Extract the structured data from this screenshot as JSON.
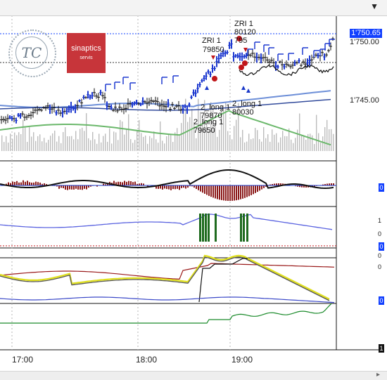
{
  "window": {
    "menu_glyph": "▼"
  },
  "price_axis": {
    "current": "1'750.65",
    "level_1": "1'750.00",
    "level_2": "1'745.00"
  },
  "annotations": [
    {
      "text": "ZRI 1",
      "x": 287,
      "y": 52
    },
    {
      "text": "79850",
      "x": 288,
      "y": 65
    },
    {
      "text": "ZRI 1",
      "x": 333,
      "y": 28
    },
    {
      "text": "80120",
      "x": 333,
      "y": 40
    },
    {
      "text": "795",
      "x": 333,
      "y": 52
    },
    {
      "text": "2_long 1",
      "x": 285,
      "y": 147
    },
    {
      "text": "79870",
      "x": 285,
      "y": 159
    },
    {
      "text": "2_long 1",
      "x": 330,
      "y": 142
    },
    {
      "text": "80030",
      "x": 330,
      "y": 154
    },
    {
      "text": "2_long 1",
      "x": 275,
      "y": 168
    },
    {
      "text": "79650",
      "x": 275,
      "y": 180
    }
  ],
  "logo": {
    "circle_text": "ТС",
    "brand_name": "sinaptics",
    "brand_sub": "servis"
  },
  "indicator_axis": {
    "p1_badge": "0",
    "p2_top": "1",
    "p2_mid": "0",
    "p2_badge": "0",
    "p3_top": "0",
    "p3_mid": "0",
    "p3_badge": "0",
    "p4_badge": "1"
  },
  "time_axis": [
    "17:00",
    "18:00",
    "19:00"
  ],
  "colors": {
    "up": "#1f3ad0",
    "down": "#111111",
    "histogram": "#8b1a1a",
    "green": "#1a8a2a",
    "yellow": "#d8d820"
  },
  "chart_data": {
    "type": "candlestick",
    "x_ticks": [
      "17:00",
      "18:00",
      "19:00"
    ],
    "price_levels": [
      1750.65,
      1750.0,
      1745.0
    ],
    "markers": [
      {
        "label": "ZRI 1",
        "value": 79850
      },
      {
        "label": "ZRI 1",
        "value": 80120
      },
      {
        "label": "2_long 1",
        "value": 79870
      },
      {
        "label": "2_long 1",
        "value": 80030
      },
      {
        "label": "2_long 1",
        "value": 79650
      }
    ]
  }
}
